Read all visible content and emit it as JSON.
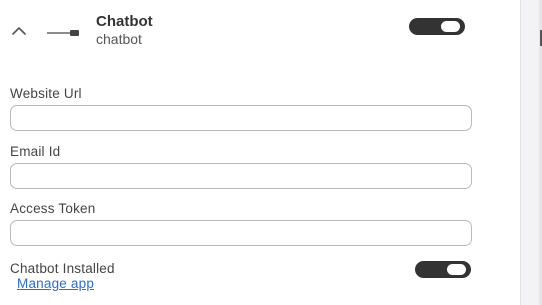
{
  "header": {
    "title": "Chatbot",
    "subtitle": "chatbot",
    "collapse_icon": "chevron-up-icon",
    "connector_icon": "plug-connector-icon",
    "enabled": true
  },
  "form": {
    "website_url": {
      "label": "Website Url",
      "value": "",
      "placeholder": ""
    },
    "email_id": {
      "label": "Email Id",
      "value": "",
      "placeholder": ""
    },
    "access_token": {
      "label": "Access Token",
      "value": "",
      "placeholder": ""
    }
  },
  "installed": {
    "label": "Chatbot Installed",
    "enabled": true
  },
  "manage_link": {
    "label": "Manage app"
  },
  "colors": {
    "toggle_on": "#333333",
    "link": "#2d6fc6",
    "input_border": "#b9b9bf"
  }
}
